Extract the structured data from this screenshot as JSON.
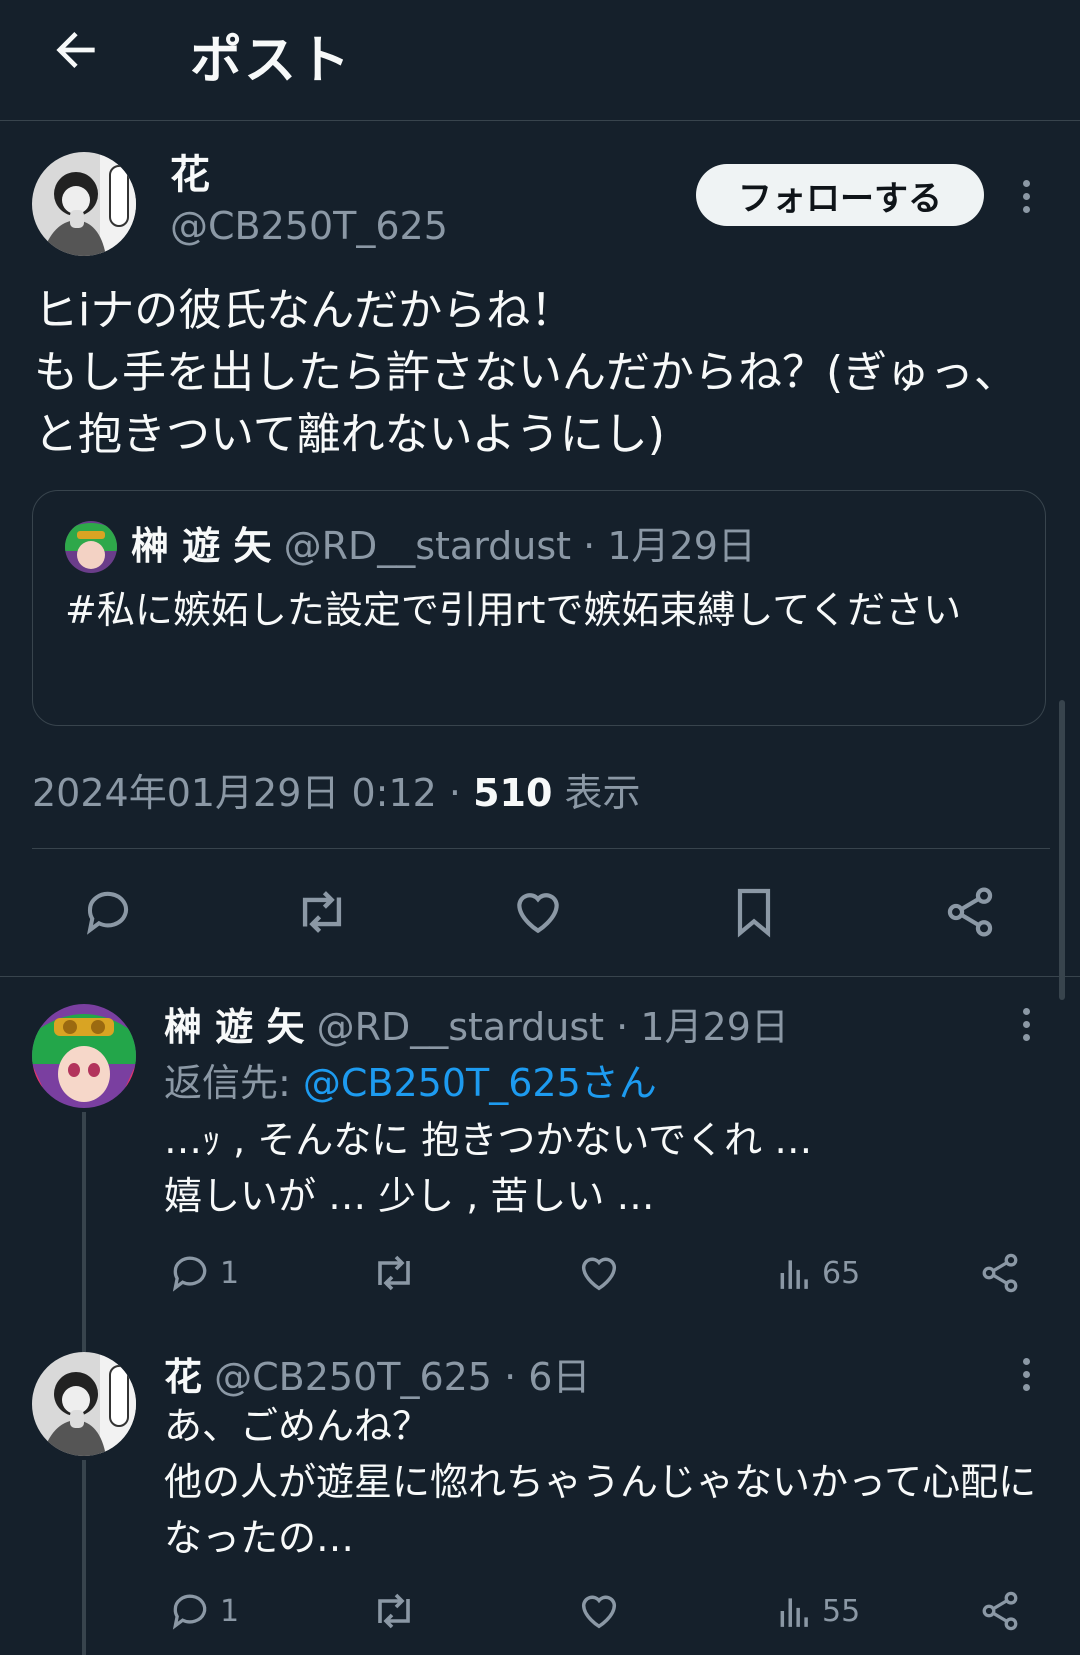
{
  "header": {
    "title": "ポスト"
  },
  "main_post": {
    "author_name": "花",
    "handle": "@CB250T_625",
    "follow_label": "フォローする",
    "text": "ヒiナの彼氏なんだからね！\nもし手を出したら許さないんだからね？(ぎゅっ、と抱きついて離れないようにし)",
    "quote": {
      "author_name": "榊 遊 矢",
      "handle": "@RD__stardust",
      "date": "1月29日",
      "text": "#私に嫉妬した設定で引用rtで嫉妬束縛してください"
    },
    "timestamp": "2024年01月29日 0:12",
    "views_count": "510",
    "views_label": "表示"
  },
  "replies": [
    {
      "author_name": "榊 遊 矢",
      "handle": "@RD__stardust",
      "date": "1月29日",
      "reply_to_prefix": "返信先: ",
      "reply_to_mention": "@CB250T_625さん",
      "text": "…ｯ , そんなに 抱きつかないでくれ …\n嬉しいが … 少し , 苦しい …",
      "reply_count": "1",
      "view_count": "65"
    },
    {
      "author_name": "花",
      "handle": "@CB250T_625",
      "date": "6日",
      "text": "あ、ごめんね？\n他の人が遊星に惚れちゃうんじゃないかって心配になったの…",
      "reply_count": "1",
      "view_count": "55"
    }
  ],
  "icons": [
    "back-arrow-icon",
    "more-icon",
    "reply-icon",
    "retweet-icon",
    "like-icon",
    "bookmark-icon",
    "share-icon",
    "views-icon"
  ],
  "colors": {
    "background": "#15202b",
    "text": "#f7f9f9",
    "muted": "#8b98a5",
    "accent": "#1d9bf0",
    "border": "#38444d"
  }
}
